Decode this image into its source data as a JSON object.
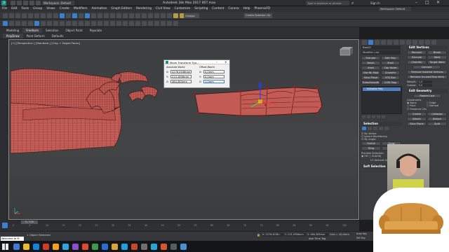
{
  "title_bar": {
    "workspace": "Workspace: Default",
    "title": "Autodesk 3ds Max 2017    007.max",
    "search_placeholder": "Type a keyword or phrase",
    "sign_in": "Sign In"
  },
  "menu": [
    "File",
    "Edit",
    "Tools",
    "Group",
    "Views",
    "Create",
    "Modifiers",
    "Animation",
    "Graph Editors",
    "Rendering",
    "Civil View",
    "Customize",
    "Scripting",
    "Content",
    "Corona",
    "Help",
    "PhoenixFD"
  ],
  "toolbar": {
    "selection_set": "Create Selection Se",
    "view_dropdown": "Viewpo",
    "layer": "0 (default)"
  },
  "ribbon_tabs": [
    "Modeling",
    "Freeform",
    "Selection",
    "Object Paint",
    "Populate"
  ],
  "ribbon_subtabs": [
    "PolyDraw",
    "Paint Deform",
    "Defaults"
  ],
  "viewport_label": "[+] [Perspective ] [Standard ] [Clay + Edged Faces]",
  "dialog": {
    "title": "Move Transform Typ...",
    "absolute_label": "Absolute:World",
    "offset_label": "Offset:World",
    "abs": [
      {
        "axis": "X:",
        "value": "2276,4036mm"
      },
      {
        "axis": "Y:",
        "value": "213,1856mm"
      },
      {
        "axis": "Z:",
        "value": "464,383mm"
      }
    ],
    "off": [
      {
        "axis": "X:",
        "value": "0,0mm"
      },
      {
        "axis": "Y:",
        "value": "0,0mm"
      },
      {
        "axis": "Z:",
        "value": "1,0mm"
      }
    ]
  },
  "command_panel": {
    "object_name": "Box02",
    "modifier_list": "Modifier List",
    "buttons_left": [
      "Extrude",
      "Bevel",
      "Inset",
      "Use Nk Mod",
      "Slice Plane",
      "TurboSmooth"
    ],
    "buttons_mid": [
      "Edit Poly",
      "Shell",
      "Cap Holes",
      "Chamfer",
      "FFD Box",
      "UVW Map"
    ],
    "stack_item": "Editable Poly",
    "edit_vertices_title": "Edit Vertices",
    "edit_vertices_buttons": [
      "Remove",
      "Break",
      "Extrude",
      "Weld",
      "Chamfer",
      "Target Weld",
      "Connect"
    ],
    "remove_isolated": "Remove Isolated Vertices",
    "remove_unused": "Remove Unused Map Verts",
    "weight_label": "Weight:",
    "weight_value": "1,0",
    "crease_label": "Crease:",
    "crease_value": "0,0",
    "edit_geometry_title": "Edit Geometry",
    "repeat_last": "Repeat Last",
    "constraints_label": "Constraints",
    "constraint_options": [
      "None",
      "Edge",
      "Face",
      "Normal"
    ],
    "preserve_uvs": "Preserve UVs",
    "create_btn": "Create",
    "collapse_btn": "Collapse",
    "attach_btn": "Attach",
    "detach_btn": "Detach",
    "slice_plane_btn": "Slice Plane",
    "split_btn": "Split",
    "selection_title": "Selection",
    "by_vertex": "By Vertex",
    "ignore_backfacing": "Ignore Backfacing",
    "by_angle": "By Angle:",
    "shrink": "Shrink",
    "grow": "Grow",
    "ring": "Ring",
    "loop": "Loop",
    "preview_selection": "Preview Selection",
    "preview_off": "Off",
    "preview_subobj": "SubObj",
    "vertices_selected": "12 Vertices Selected",
    "soft_selection_title": "Soft Selection"
  },
  "timeline": {
    "frame": "0 / 100",
    "ticks": [
      "0",
      "5",
      "10",
      "15",
      "20",
      "25",
      "30",
      "35",
      "40",
      "45",
      "50",
      "55",
      "60",
      "65",
      "70",
      "75",
      "80",
      "85",
      "90",
      "95",
      "100"
    ]
  },
  "status": {
    "selected": "1 Object Selected",
    "maxscript": "Welcome to M",
    "x": "X: 2276,4036 r",
    "y": "Y: 213,1856mm",
    "z": "Z: 464,383mm",
    "grid": "Grid = 10,0mm",
    "add_time_tag": "Add Time Tag",
    "auto_key": "Auto Key",
    "selected_btn": "Selected",
    "set_key": "Set Key",
    "key_filters": "Key Filters..."
  },
  "taskbar_colors": [
    "#3f7ad6",
    "#e8bb2c",
    "#0f86d6",
    "#d23b2b",
    "#f2a01e",
    "#2ea3dd",
    "#8a4fc9",
    "#e04a2c",
    "#3b9a4c",
    "#2a6dd1",
    "#d8a33a",
    "#1f9fe0",
    "#c34a2e",
    "#6f6f6f",
    "#29a6d4",
    "#d6562e",
    "#555c63",
    "#4a8fd6"
  ],
  "colors": {
    "accent": "#3b7fcf",
    "sofa": "#c85d56",
    "viewport": "#414244"
  }
}
